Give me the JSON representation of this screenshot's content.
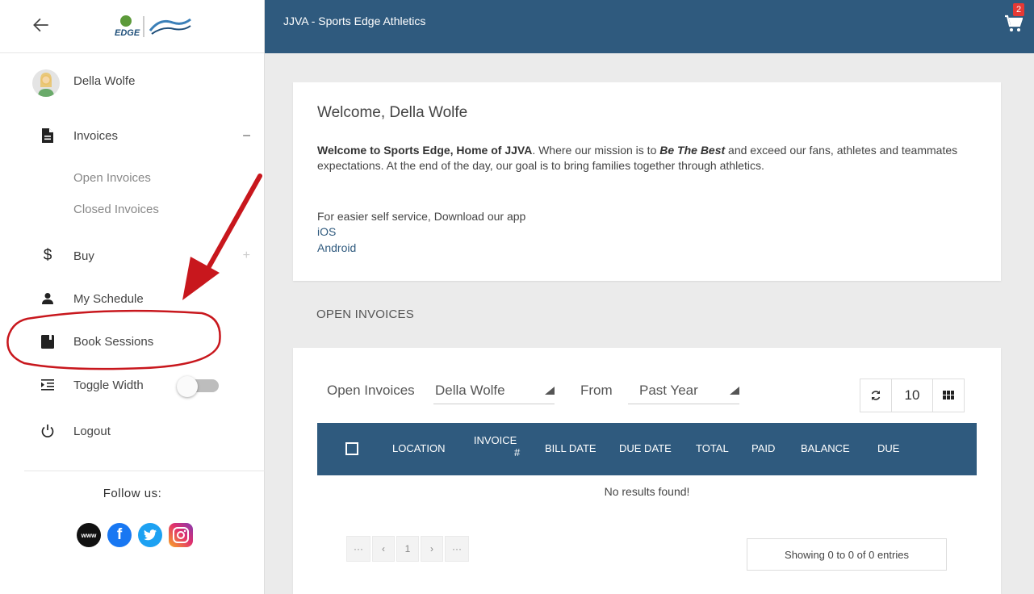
{
  "sidebar": {
    "user_name": "Della Wolfe",
    "items": {
      "invoices": {
        "label": "Invoices",
        "toggle": "–"
      },
      "open_invoices": {
        "label": "Open Invoices"
      },
      "closed_invoices": {
        "label": "Closed Invoices"
      },
      "buy": {
        "label": "Buy",
        "toggle": "+"
      },
      "my_schedule": {
        "label": "My Schedule"
      },
      "book_sessions": {
        "label": "Book Sessions"
      },
      "toggle_width": {
        "label": "Toggle Width"
      },
      "logout": {
        "label": "Logout"
      }
    },
    "follow_us": "Follow us:",
    "logo_text": "EDGE",
    "socials": [
      {
        "name": "website",
        "icon": "www-icon",
        "glyph": "www"
      },
      {
        "name": "facebook",
        "icon": "facebook-icon",
        "glyph": "f"
      },
      {
        "name": "twitter",
        "icon": "twitter-icon",
        "glyph": "t"
      },
      {
        "name": "instagram",
        "icon": "instagram-icon",
        "glyph": "ig"
      }
    ]
  },
  "header": {
    "title": "JJVA - Sports Edge Athletics",
    "cart_count": "2",
    "color": "#2f5a7e"
  },
  "welcome": {
    "title": "Welcome, Della Wolfe",
    "intro_bold": "Welcome to Sports Edge, Home of JJVA",
    "intro_mid": ". Where our mission is to ",
    "intro_em": "Be The Best",
    "intro_rest": " and exceed our fans, athletes and teammates expectations. At the end of the day, our goal is to bring families together through athletics.",
    "self_service": "For easier self service, Download our app",
    "links": [
      "iOS",
      "Android"
    ]
  },
  "open_invoices": {
    "section_title": "OPEN INVOICES",
    "filter_label": "Open Invoices",
    "filter_person": "Della Wolfe",
    "from_label": "From",
    "from_value": "Past Year",
    "page_size": "10",
    "columns": [
      "LOCATION",
      "INVOICE #",
      "BILL DATE",
      "DUE DATE",
      "TOTAL",
      "PAID",
      "BALANCE",
      "DUE"
    ],
    "invoice_col_top": "INVOICE",
    "invoice_col_bottom": "#",
    "empty_message": "No results found!",
    "pager": [
      "···",
      "‹",
      "1",
      "›",
      "···"
    ],
    "showing": "Showing 0 to 0 of 0 entries"
  },
  "colors": {
    "accent": "#2f5a7e",
    "annotation": "#c8171d",
    "badge": "#e53935"
  }
}
